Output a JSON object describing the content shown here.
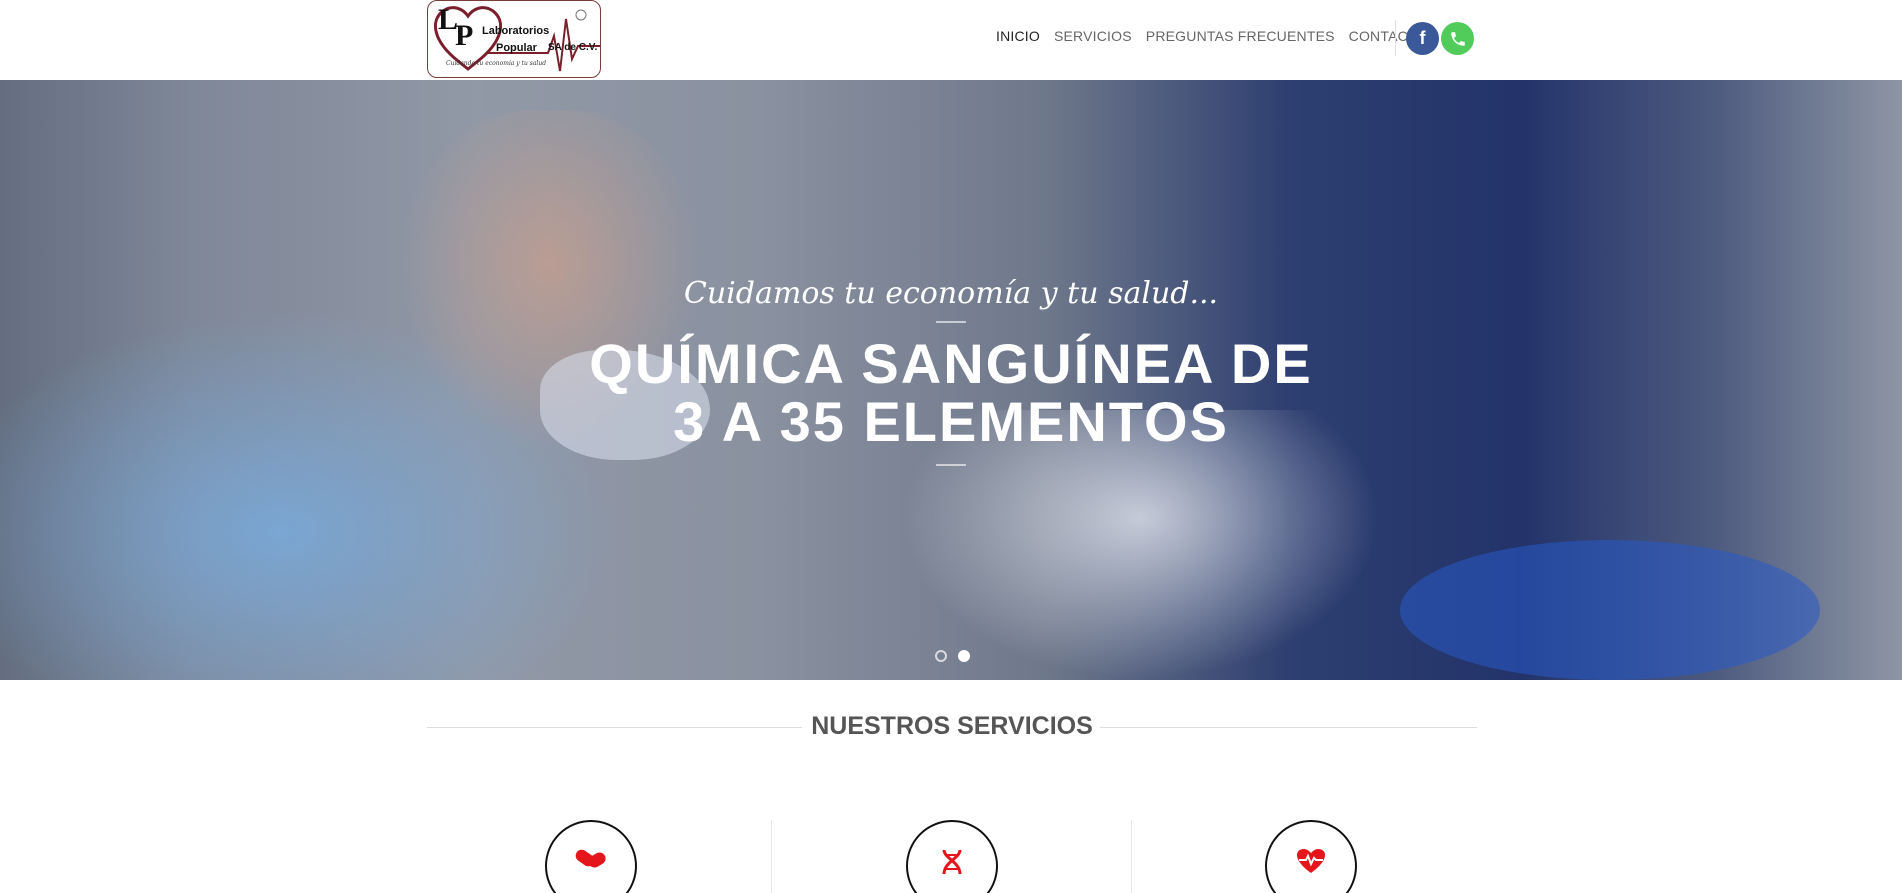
{
  "header": {
    "logo": {
      "letters": "LP",
      "line1": "Laboratorios",
      "line2": "Popular",
      "line3": "SA de C.V.",
      "tagline": "Cuidando tu economía y tu salud"
    },
    "nav": [
      {
        "label": "INICIO",
        "active": true
      },
      {
        "label": "SERVICIOS",
        "active": false
      },
      {
        "label": "PREGUNTAS FRECUENTES",
        "active": false
      },
      {
        "label": "CONTACTO",
        "active": false
      }
    ],
    "social": [
      {
        "name": "facebook-icon",
        "glyph": "f",
        "color": "#3b5998"
      },
      {
        "name": "phone-icon",
        "color": "#51cb5a"
      }
    ]
  },
  "hero": {
    "script_line": "Cuidamos tu economía y tu salud...",
    "title_line1": "QUÍMICA SANGUÍNEA DE",
    "title_line2": "3 A 35 ELEMENTOS",
    "slides": 2,
    "active_slide": 2
  },
  "services": {
    "title": "NUESTROS SERVICIOS",
    "items": [
      {
        "icon": "pills-icon"
      },
      {
        "icon": "dna-icon"
      },
      {
        "icon": "heart-pulse-icon"
      }
    ],
    "accent_color": "#e4161b"
  }
}
